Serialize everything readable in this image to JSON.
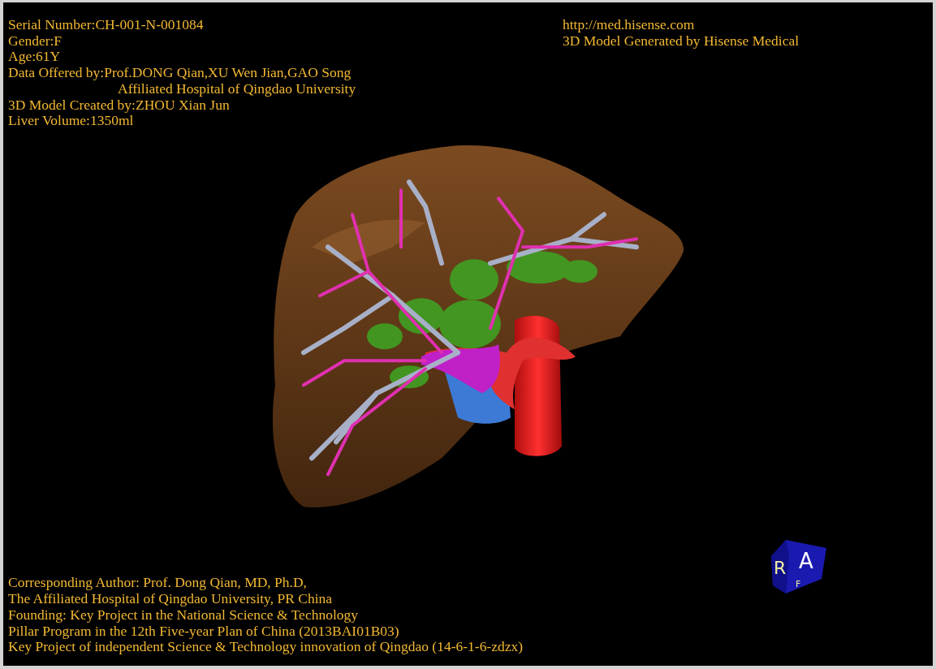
{
  "patient_info": [
    {
      "text": "Serial Number:CH-001-N-001084",
      "indented": false
    },
    {
      "text": "Gender:F",
      "indented": false
    },
    {
      "text": "Age:61Y",
      "indented": false
    },
    {
      "text": "Data Offered by:Prof.DONG Qian,XU Wen Jian,GAO Song",
      "indented": false
    },
    {
      "text": "Affiliated Hospital of Qingdao University",
      "indented": true
    },
    {
      "text": "3D Model Created by:ZHOU Xian Jun",
      "indented": false
    },
    {
      "text": "Liver Volume:1350ml",
      "indented": false
    }
  ],
  "generator_info": [
    "http://med.hisense.com",
    "3D Model Generated by Hisense Medical"
  ],
  "credits": [
    "Corresponding Author: Prof. Dong Qian, MD, Ph.D,",
    "The Affiliated Hospital of Qingdao University, PR China",
    "Founding: Key Project in the National Science & Technology",
    "Pillar Program in the 12th Five-year Plan of China (2013BAI01B03)",
    "Key Project of independent Science & Technology innovation of Qingdao (14-6-1-6-zdzx)"
  ],
  "orientation_cube": {
    "left_face": "R",
    "front_face": "A",
    "bottom_face": "F"
  }
}
